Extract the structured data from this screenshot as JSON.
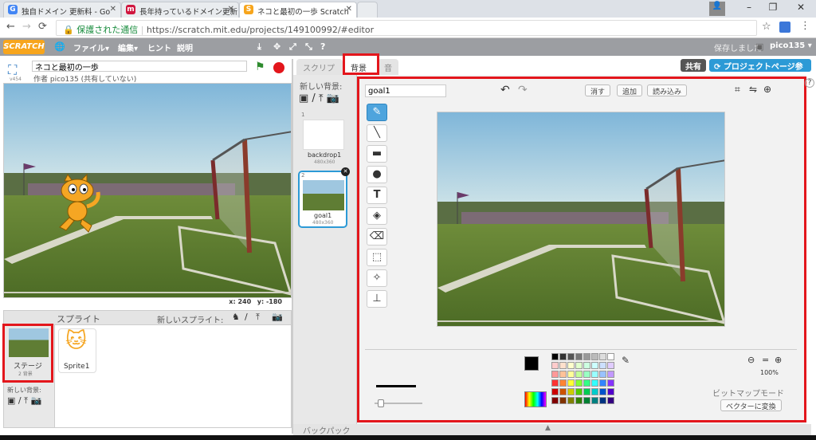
{
  "browser": {
    "tabs": [
      {
        "title": "独自ドメイン 更新料 - Go",
        "fav": "G",
        "favcolor": "#4285f4"
      },
      {
        "title": "長年持っているドメイン更新",
        "fav": "m",
        "favcolor": "#d0163f"
      },
      {
        "title": "ネコと最初の一歩 Scratch",
        "fav": "S",
        "favcolor": "#f7a51c"
      }
    ],
    "security_label": "保護された通信",
    "url": "https://scratch.mit.edu/projects/149100992/#editor"
  },
  "menubar": {
    "logo": "SCRATCH",
    "file": "ファイル▾",
    "edit": "編集▾",
    "tips": "ヒント",
    "about": "説明",
    "saved": "保存しました",
    "user": "pico135 ▾"
  },
  "project": {
    "title": "ネコと最初の一歩",
    "author": "作者 pico135 (共有していない)",
    "version": "v454",
    "coords_x": "x: 240",
    "coords_y": "y: -180"
  },
  "sprites_pane": {
    "header": "スプライト",
    "new_sprite": "新しいスプライト:",
    "stage_label": "ステージ",
    "stage_sub": "2 背景",
    "new_backdrop": "新しい背景:",
    "sprite1": "Sprite1"
  },
  "center": {
    "tab_scripts": "スクリプト",
    "tab_backdrops": "背景",
    "tab_sounds": "音",
    "new_backdrop": "新しい背景:",
    "share": "共有",
    "project_page": "プロジェクトページ参照",
    "backdrops": [
      {
        "num": "1",
        "name": "backdrop1",
        "size": "480x360"
      },
      {
        "num": "2",
        "name": "goal1",
        "size": "480x360"
      }
    ],
    "backpack": "バックパック"
  },
  "editor": {
    "costume_name": "goal1",
    "clear": "消す",
    "add": "追加",
    "import": "読み込み",
    "zoom": "100%",
    "mode": "ビットマップモード",
    "convert": "ベクターに変換"
  },
  "palette": [
    "#000000",
    "#333333",
    "#555555",
    "#777777",
    "#999999",
    "#bbbbbb",
    "#dddddd",
    "#ffffff",
    "#ffcccc",
    "#ffe0cc",
    "#ffffcc",
    "#e0ffcc",
    "#ccffe0",
    "#ccffff",
    "#cce0ff",
    "#e0ccff",
    "#ff9999",
    "#ffc299",
    "#ffff99",
    "#c2ff99",
    "#99ffc2",
    "#99ffff",
    "#99c2ff",
    "#c299ff",
    "#ff3333",
    "#ff8533",
    "#ffff33",
    "#85ff33",
    "#33ff85",
    "#33ffff",
    "#3385ff",
    "#8533ff",
    "#cc0000",
    "#cc5200",
    "#cccc00",
    "#52cc00",
    "#00cc52",
    "#00cccc",
    "#0052cc",
    "#5200cc",
    "#800000",
    "#803300",
    "#808000",
    "#338000",
    "#008033",
    "#008080",
    "#003380",
    "#330080"
  ]
}
